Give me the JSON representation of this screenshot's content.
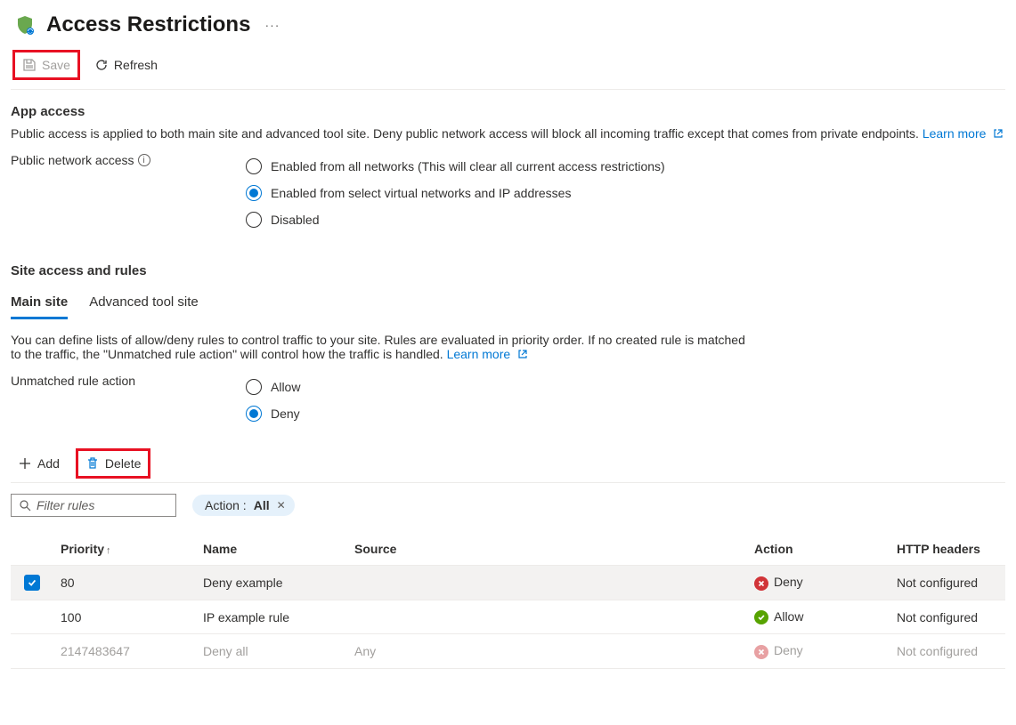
{
  "header": {
    "title": "Access Restrictions"
  },
  "toolbar": {
    "save_label": "Save",
    "refresh_label": "Refresh"
  },
  "app_access": {
    "heading": "App access",
    "description": "Public access is applied to both main site and advanced tool site. Deny public network access will block all incoming traffic except that comes from private endpoints.",
    "learn_more": "Learn more",
    "public_network_label": "Public network access",
    "options": {
      "enabled_all": "Enabled from all networks (This will clear all current access restrictions)",
      "enabled_select": "Enabled from select virtual networks and IP addresses",
      "disabled": "Disabled"
    }
  },
  "site_access": {
    "heading": "Site access and rules",
    "tabs": {
      "main": "Main site",
      "advanced": "Advanced tool site"
    },
    "description": "You can define lists of allow/deny rules to control traffic to your site. Rules are evaluated in priority order. If no created rule is matched to the traffic, the \"Unmatched rule action\" will control how the traffic is handled.",
    "learn_more": "Learn more",
    "unmatched_label": "Unmatched rule action",
    "unmatched_options": {
      "allow": "Allow",
      "deny": "Deny"
    }
  },
  "rules_toolbar": {
    "add_label": "Add",
    "delete_label": "Delete"
  },
  "filter": {
    "placeholder": "Filter rules",
    "action_pill_label": "Action :",
    "action_pill_value": "All"
  },
  "columns": {
    "priority": "Priority",
    "name": "Name",
    "source": "Source",
    "action": "Action",
    "http_headers": "HTTP headers"
  },
  "rows": [
    {
      "checked": true,
      "selected": true,
      "muted": false,
      "priority": "80",
      "name": "Deny example",
      "source": "",
      "action_kind": "deny",
      "action_label": "Deny",
      "http": "Not configured"
    },
    {
      "checked": false,
      "selected": false,
      "muted": false,
      "priority": "100",
      "name": "IP example rule",
      "source": "",
      "action_kind": "allow",
      "action_label": "Allow",
      "http": "Not configured"
    },
    {
      "checked": false,
      "selected": false,
      "muted": true,
      "priority": "2147483647",
      "name": "Deny all",
      "source": "Any",
      "action_kind": "deny",
      "action_label": "Deny",
      "http": "Not configured"
    }
  ]
}
